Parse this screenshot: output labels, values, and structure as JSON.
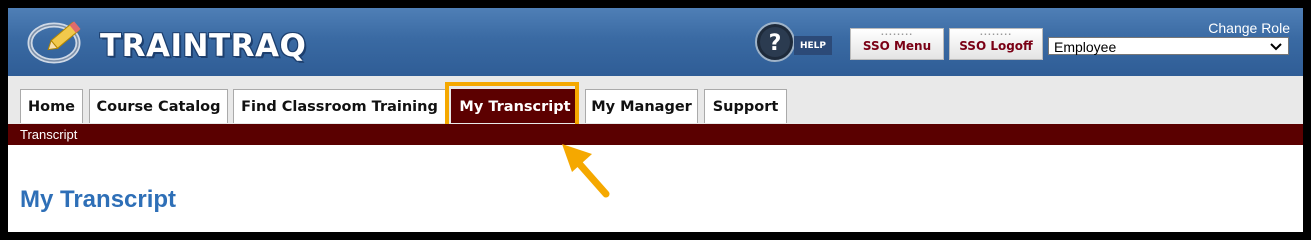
{
  "header": {
    "logo_text": "TRAINTRAQ",
    "help_label": "HELP",
    "sso_menu_label": "SSO Menu",
    "sso_logoff_label": "SSO Logoff",
    "change_role_label": "Change Role",
    "role_selected": "Employee"
  },
  "nav": {
    "tabs": [
      {
        "label": "Home"
      },
      {
        "label": "Course Catalog"
      },
      {
        "label": "Find Classroom Training"
      },
      {
        "label": "My Transcript",
        "active": true
      },
      {
        "label": "My Manager"
      },
      {
        "label": "Support"
      }
    ]
  },
  "breadcrumb": "Transcript",
  "main": {
    "title": "My Transcript"
  },
  "colors": {
    "header_blue": "#3a6aa3",
    "active_tab": "#5c0000",
    "crumb_bar": "#5a0000",
    "highlight": "#f5a800",
    "title_blue": "#2e6fb7"
  }
}
